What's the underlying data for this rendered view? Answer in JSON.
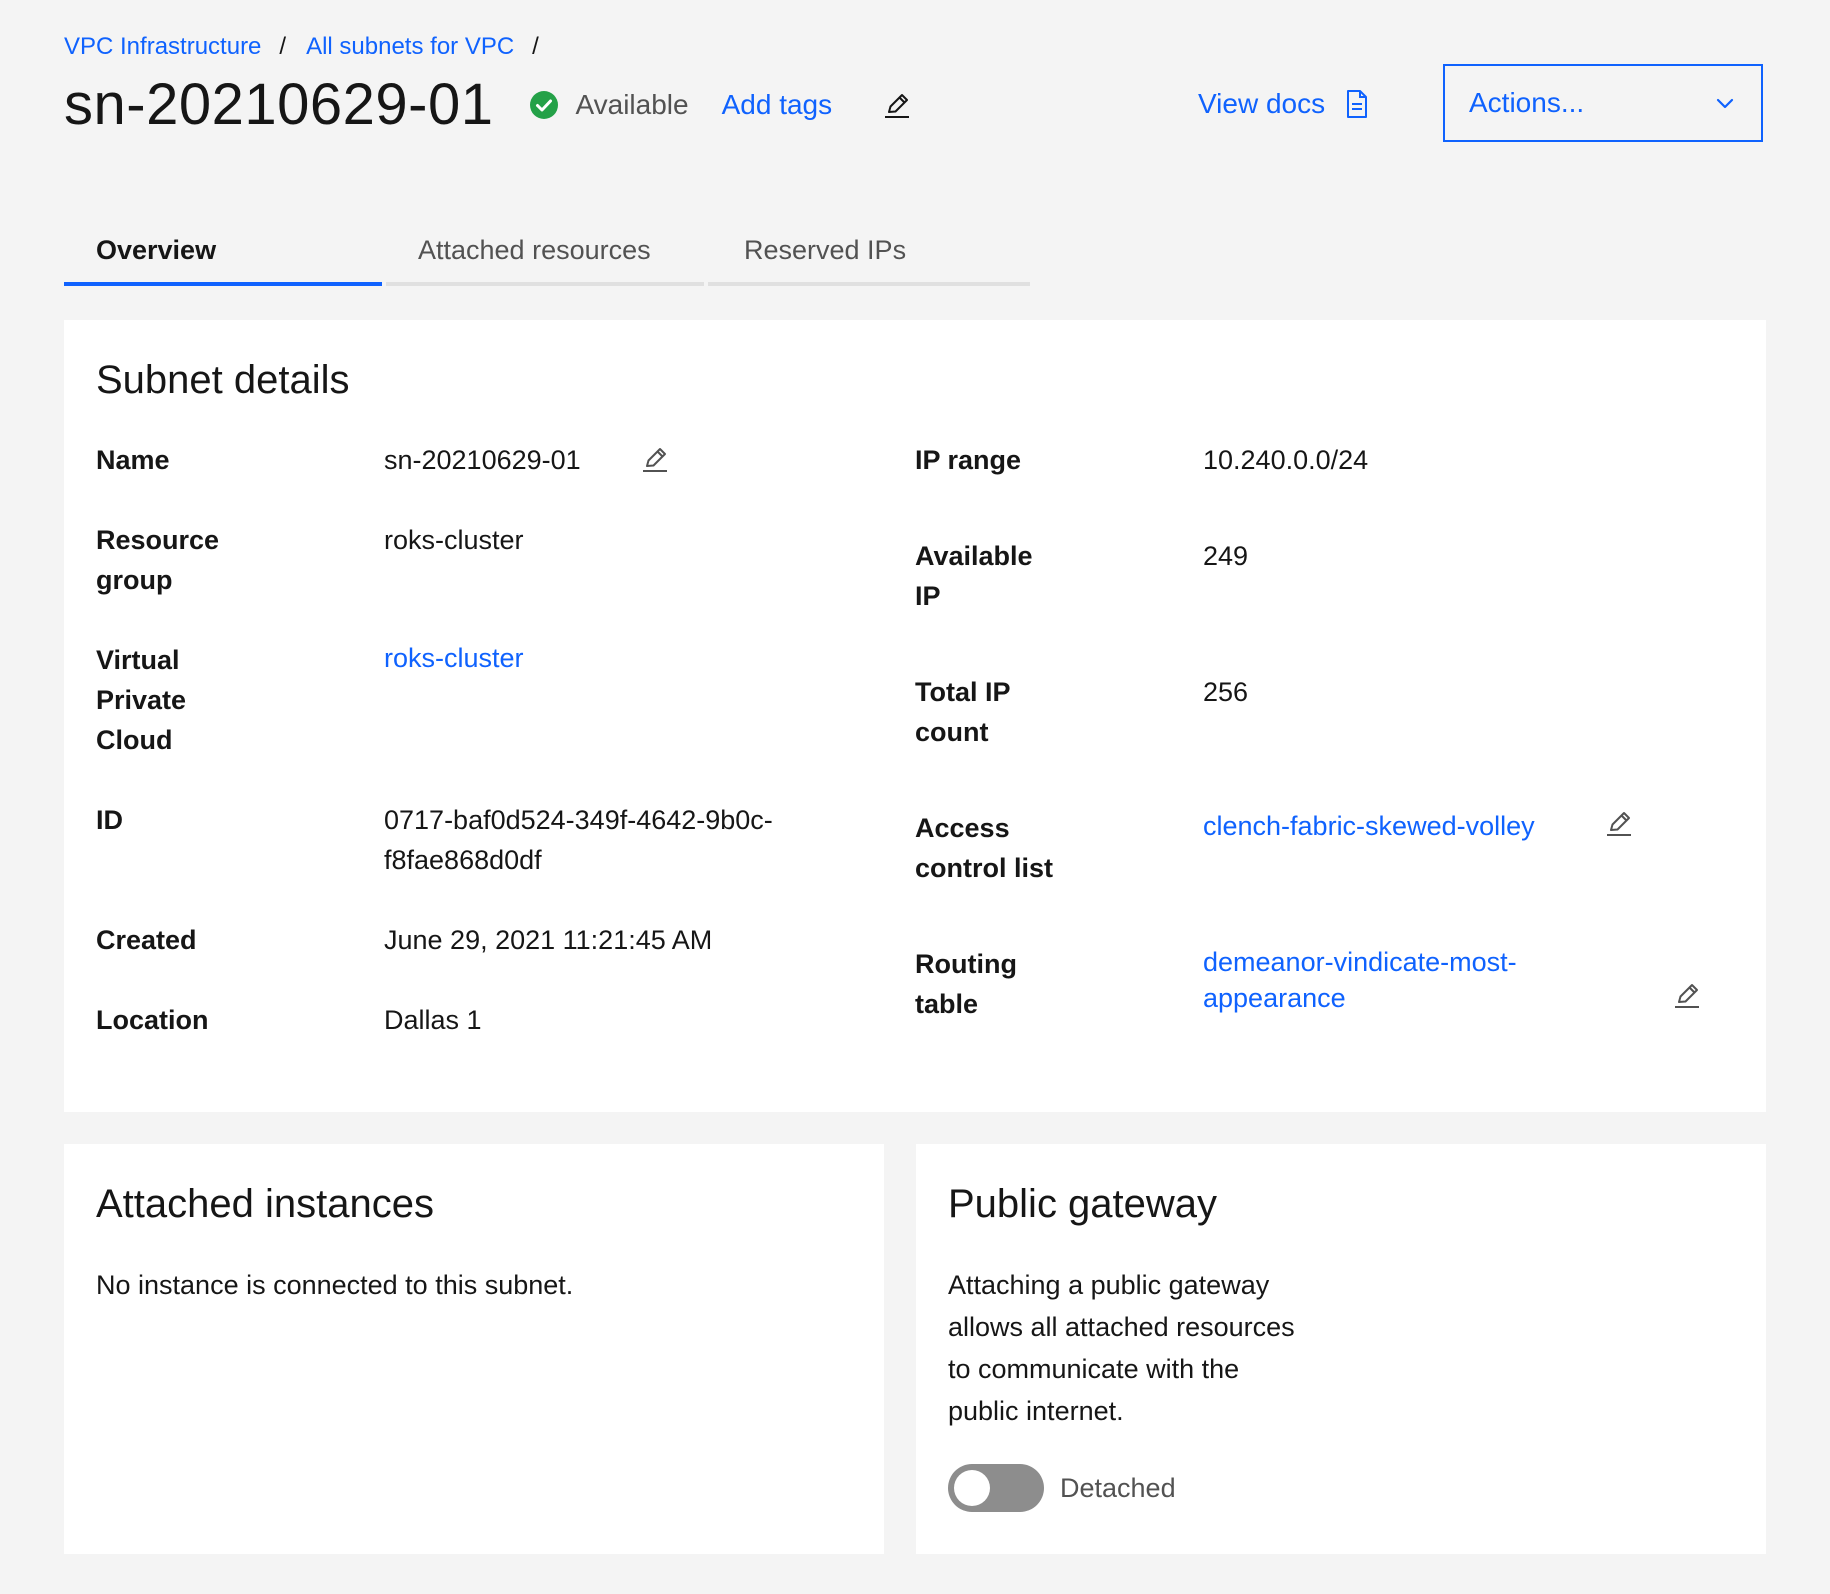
{
  "breadcrumb": {
    "items": [
      "VPC Infrastructure",
      "All subnets for VPC"
    ],
    "separator": "/"
  },
  "header": {
    "title": "sn-20210629-01",
    "status": "Available",
    "add_tags": "Add tags",
    "view_docs": "View docs",
    "actions": "Actions..."
  },
  "tabs": [
    "Overview",
    "Attached resources",
    "Reserved IPs"
  ],
  "subnet_details": {
    "title": "Subnet details",
    "left": {
      "name_label": "Name",
      "name_value": "sn-20210629-01",
      "rg_label_1": "Resource",
      "rg_label_2": "group",
      "rg_value": "roks-cluster",
      "vpc_label_1": "Virtual",
      "vpc_label_2": "Private",
      "vpc_label_3": "Cloud",
      "vpc_value": "roks-cluster",
      "id_label": "ID",
      "id_value_1": "0717-baf0d524-349f-4642-9b0c-",
      "id_value_2": "f8fae868d0df",
      "created_label": "Created",
      "created_value": "June 29, 2021 11:21:45 AM",
      "location_label": "Location",
      "location_value": "Dallas 1"
    },
    "right": {
      "ip_range_label": "IP range",
      "ip_range_value": "10.240.0.0/24",
      "avail_label_1": "Available",
      "avail_label_2": "IP",
      "avail_value": "249",
      "total_label_1": "Total IP",
      "total_label_2": "count",
      "total_value": "256",
      "acl_label_1": "Access",
      "acl_label_2": "control list",
      "acl_value": "clench-fabric-skewed-volley",
      "rt_label_1": "Routing",
      "rt_label_2": "table",
      "rt_value_1": "demeanor-vindicate-most-",
      "rt_value_2": "appearance"
    }
  },
  "attached_instances": {
    "title": "Attached instances",
    "message": "No instance is connected to this subnet."
  },
  "public_gateway": {
    "title": "Public gateway",
    "lines": [
      "Attaching a public gateway",
      "allows all attached resources",
      "to communicate with the",
      "public internet."
    ],
    "toggle_label": "Detached",
    "toggle_on": false
  },
  "colors": {
    "accent": "#0f62fe",
    "success": "#24a148",
    "background": "#f4f4f4",
    "card": "#ffffff"
  },
  "icons": {
    "status": "checkmark-filled-icon",
    "edit": "pencil-edit-icon",
    "docs": "document-icon",
    "dropdown": "chevron-down-icon"
  }
}
